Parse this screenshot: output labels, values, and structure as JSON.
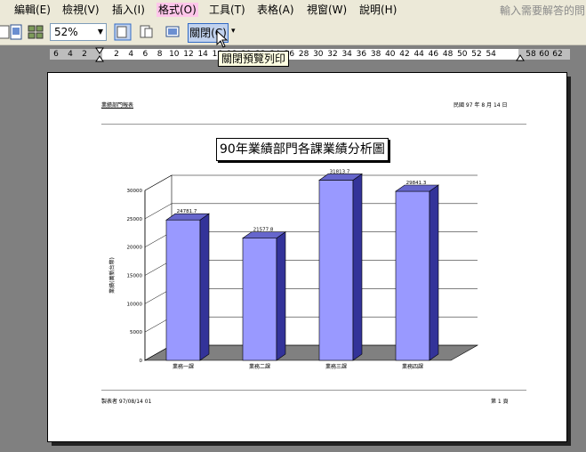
{
  "menu": {
    "items": [
      {
        "label": "編輯(E)"
      },
      {
        "label": "檢視(V)"
      },
      {
        "label": "插入(I)"
      },
      {
        "label": "格式(O)"
      },
      {
        "label": "工具(T)"
      },
      {
        "label": "表格(A)"
      },
      {
        "label": "視窗(W)"
      },
      {
        "label": "說明(H)"
      }
    ],
    "help_placeholder": "輸入需要解答的問"
  },
  "toolbar": {
    "zoom_value": "52%",
    "close_label": "關閉(C)",
    "tooltip": "關閉預覽列印"
  },
  "ruler": {
    "left_numbers": [
      "6",
      "4",
      "2"
    ],
    "numbers": [
      "2",
      "4",
      "6",
      "8",
      "10",
      "12",
      "14",
      "16",
      "18",
      "20",
      "22",
      "24",
      "26",
      "28",
      "30",
      "32",
      "34",
      "36",
      "38",
      "40",
      "42",
      "44",
      "46",
      "48",
      "50",
      "52",
      "54"
    ],
    "right_numbers": [
      "58",
      "60",
      "62"
    ]
  },
  "page": {
    "header_left": "業績部門報表",
    "header_right": "民國 97 年 8 月 14 日",
    "footer_left": "製表者    97/08/14 01",
    "footer_right": "第 1 頁"
  },
  "chart_data": {
    "type": "bar",
    "title": "90年業績部門各課業績分析圖",
    "ylabel": "業績(萬新台幣)",
    "xlabel": "",
    "categories": [
      "業務一課",
      "業務二課",
      "業務三課",
      "業務四課"
    ],
    "values": [
      24781.7,
      21577.8,
      31813.7,
      29841.3
    ],
    "data_labels": [
      "24781.7",
      "21577.8",
      "31813.7",
      "29841.3"
    ],
    "yticks": [
      "0",
      "5000",
      "10000",
      "15000",
      "20000",
      "25000",
      "30000"
    ],
    "ylim": [
      0,
      30000
    ],
    "bar_color": "#9999ff",
    "grid": true
  }
}
